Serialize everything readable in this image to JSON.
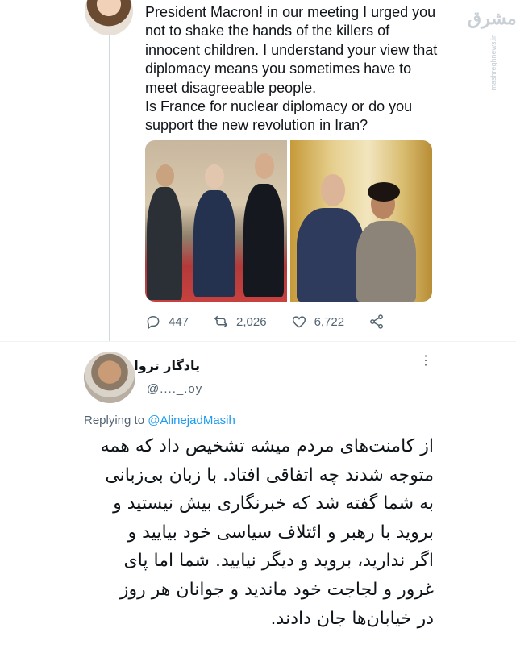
{
  "tweet": {
    "text": "President Macron! in our meeting I urged you\nnot to shake the hands of the killers of\ninnocent children. I understand your view that\ndiplomacy means you sometimes have to\nmeet disagreeable people.\nIs France for nuclear diplomacy or do you\nsupport the new revolution in Iran?",
    "replies": "447",
    "retweets": "2,026",
    "likes": "6,722"
  },
  "watermark": {
    "logo": "مشرق",
    "url": "mashreghnews.ir"
  },
  "reply": {
    "name": "یادگار تروا",
    "handle": "@...._.oy",
    "more": "⋮",
    "replying_to_label": "Replying to",
    "replying_to_handle": "@AlinejadMasih",
    "body": "از کامنت‌های مردم میشه تشخیص داد که همه\nمتوجه شدند چه اتفاقی افتاد. با زبان بی‌زبانی\nبه شما گفته شد که خبرنگاری بیش نیستید و\nبروید با رهبر و ائتلاف سیاسی خود بیایید و\nاگر ندارید، بروید و دیگر نیایید. شما اما پای\nغرور و لجاجت خود ماندید و جوانان هر روز\nدر خیابان‌ها جان دادند."
  },
  "icons": {
    "reply": "reply-icon",
    "retweet": "retweet-icon",
    "like": "heart-icon",
    "share": "share-icon"
  },
  "colors": {
    "text": "#0f1419",
    "muted": "#536471",
    "link": "#1d9bf0",
    "divider": "#eff3f4"
  }
}
